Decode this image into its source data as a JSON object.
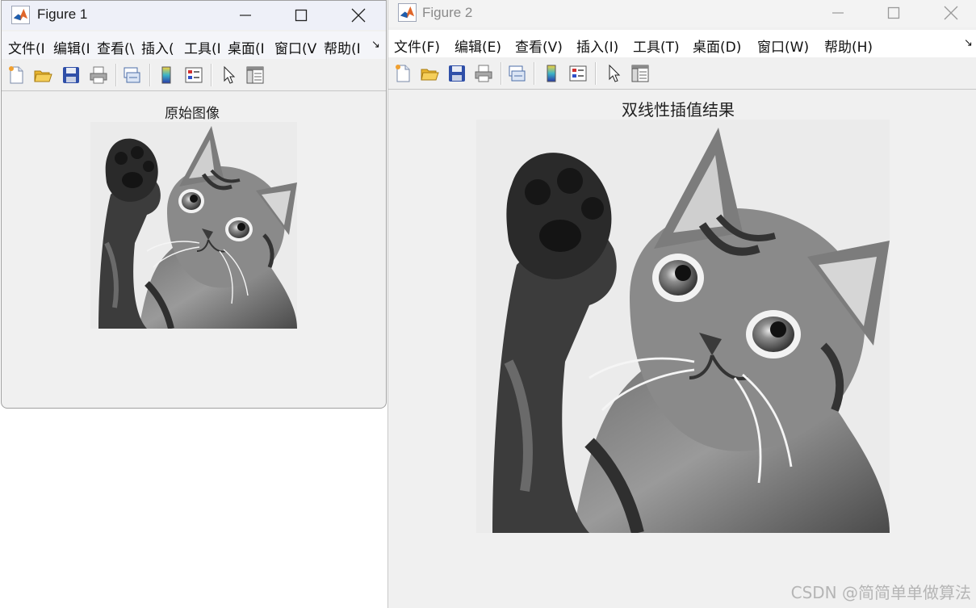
{
  "figure1": {
    "title": "Figure 1",
    "menu": [
      "文件(I",
      "编辑(I",
      "查看(\\",
      "插入(",
      "工具(I",
      "桌面(I",
      "窗口(V",
      "帮助(I"
    ],
    "menu_more": "↘",
    "axes_title": "原始图像"
  },
  "figure2": {
    "title": "Figure 2",
    "menu": [
      "文件(F)",
      "编辑(E)",
      "查看(V)",
      "插入(I)",
      "工具(T)",
      "桌面(D)",
      "窗口(W)",
      "帮助(H)"
    ],
    "menu_more": "↘",
    "axes_title": "双线性插值结果"
  },
  "toolbar_icons": [
    "new-figure-icon",
    "open-file-icon",
    "save-icon",
    "print-icon",
    "link-plot-icon",
    "colorbar-icon",
    "legend-icon",
    "pointer-icon",
    "property-inspector-icon"
  ],
  "image_content": "grayscale photo of a tabby kitten raising its paw",
  "watermark": "CSDN @简简单单做算法",
  "colors": {
    "window_bg": "#f0f0f0",
    "matlab_orange": "#e0662a",
    "matlab_blue": "#1f5fae"
  }
}
